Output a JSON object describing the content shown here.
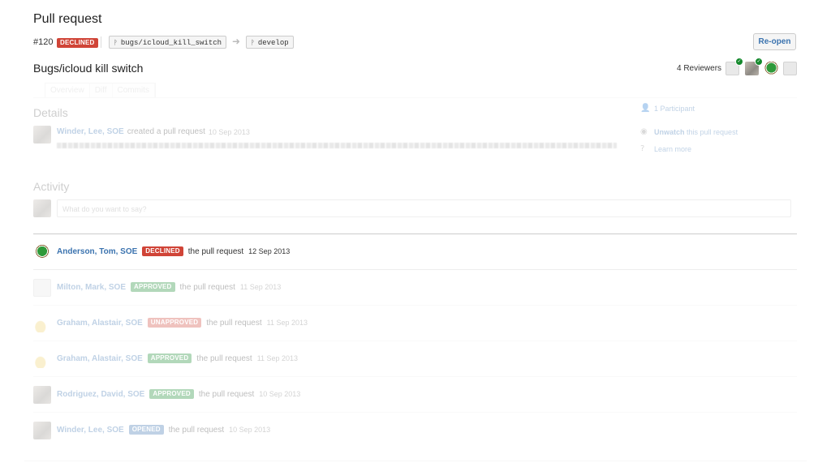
{
  "page": {
    "title": "Pull request",
    "pr_number": "#120",
    "status": "DECLINED",
    "source_branch": "bugs/icloud_kill_switch",
    "target_branch": "develop",
    "reopen_label": "Re-open",
    "pr_title": "Bugs/icloud kill switch",
    "reviewers_label": "4 Reviewers"
  },
  "tabs": [
    "Overview",
    "Diff",
    "Commits"
  ],
  "details": {
    "heading": "Details",
    "author": "Winder, Lee, SOE",
    "action": "created a pull request",
    "date": "10 Sep 2013"
  },
  "sidebar": {
    "participants": "1 Participant",
    "unwatch_label": "Unwatch",
    "unwatch_suffix": "this pull request",
    "learn_more": "Learn more"
  },
  "activity": {
    "heading": "Activity",
    "placeholder": "What do you want to say?",
    "items": [
      {
        "name": "Anderson, Tom, SOE",
        "badge": "DECLINED",
        "text": "the pull request",
        "date": "12 Sep 2013"
      },
      {
        "name": "Milton, Mark, SOE",
        "badge": "APPROVED",
        "text": "the pull request",
        "date": "11 Sep 2013"
      },
      {
        "name": "Graham, Alastair, SOE",
        "badge": "UNAPPROVED",
        "text": "the pull request",
        "date": "11 Sep 2013"
      },
      {
        "name": "Graham, Alastair, SOE",
        "badge": "APPROVED",
        "text": "the pull request",
        "date": "11 Sep 2013"
      },
      {
        "name": "Rodriguez, David, SOE",
        "badge": "APPROVED",
        "text": "the pull request",
        "date": "10 Sep 2013"
      },
      {
        "name": "Winder, Lee, SOE",
        "badge": "OPENED",
        "text": "the pull request",
        "date": "10 Sep 2013"
      }
    ]
  },
  "colors": {
    "declined": "#d04437",
    "approved": "#14892c",
    "link": "#3b73af",
    "opened": "#3b73af"
  }
}
